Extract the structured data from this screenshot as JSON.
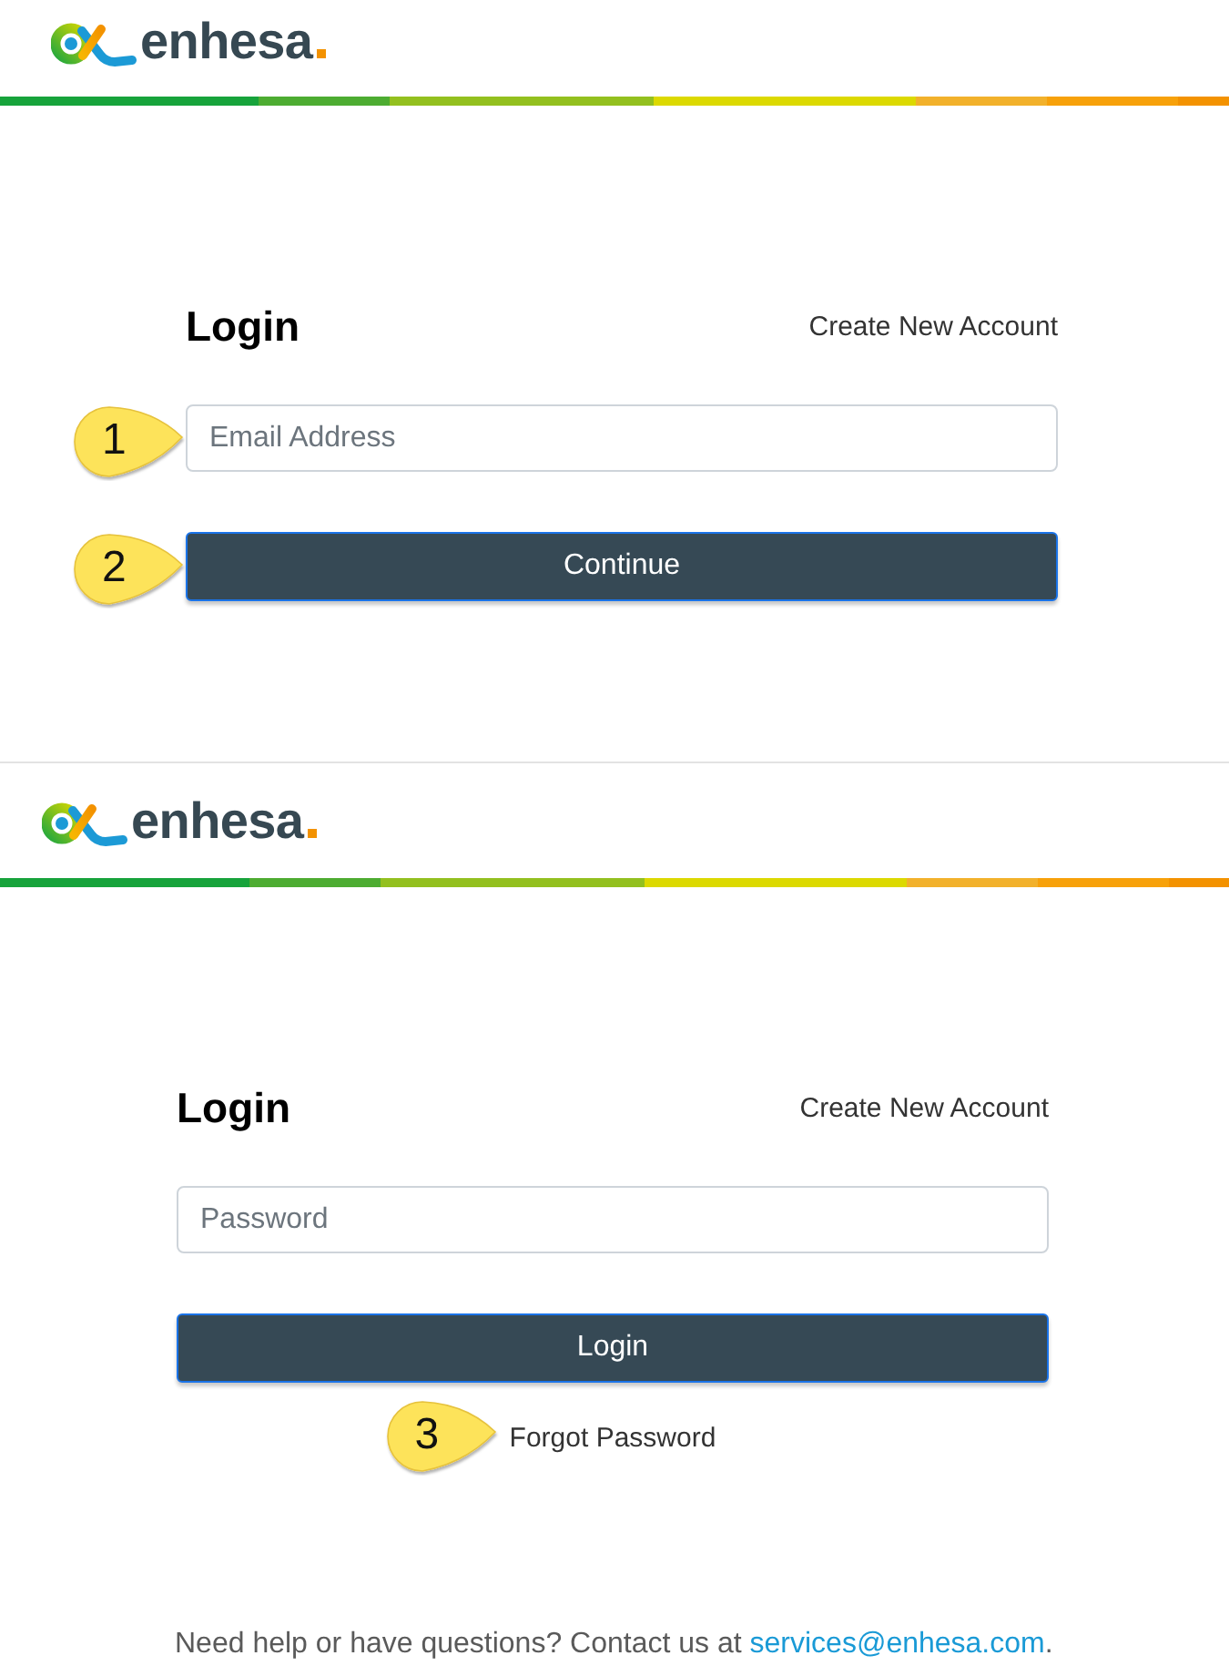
{
  "screens": [
    {
      "logo": {
        "wordmark": "enhesa"
      },
      "title": "Login",
      "create_account_link": "Create New Account",
      "field": {
        "placeholder": "Email Address",
        "callout": "1"
      },
      "button": {
        "label": "Continue",
        "callout": "2"
      }
    },
    {
      "logo": {
        "wordmark": "enhesa"
      },
      "title": "Login",
      "create_account_link": "Create New Account",
      "field": {
        "placeholder": "Password"
      },
      "button": {
        "label": "Login"
      },
      "forgot_link": {
        "label": "Forgot Password",
        "callout": "3"
      },
      "help": {
        "text": "Need help or have questions? Contact us at",
        "email": "services@enhesa.com",
        "suffix": "."
      }
    }
  ]
}
